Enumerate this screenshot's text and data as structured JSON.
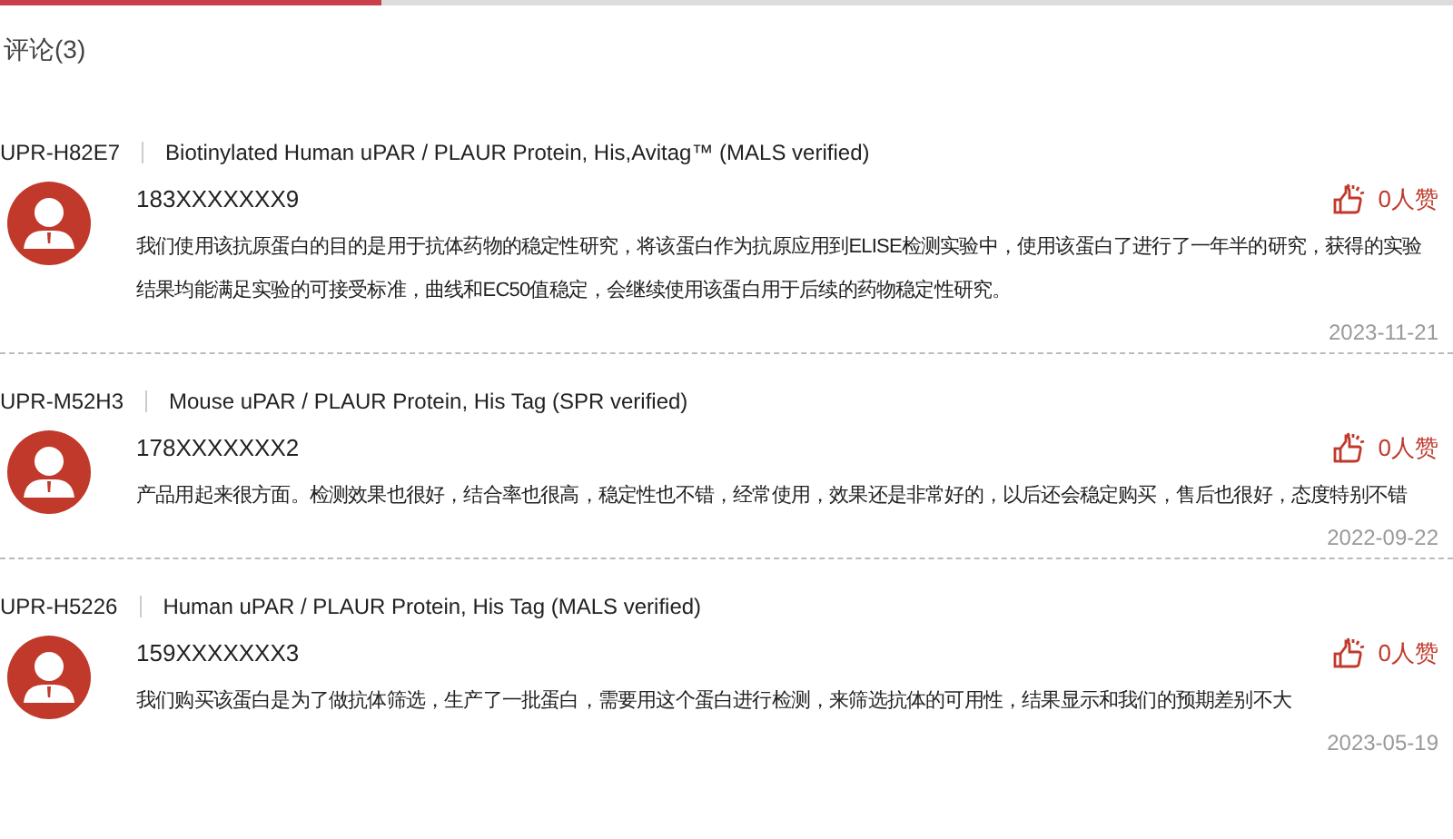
{
  "heading": "评论(3)",
  "reviews": [
    {
      "sku": "UPR-H82E7",
      "product": "Biotinylated Human uPAR / PLAUR Protein, His,Avitag™ (MALS verified)",
      "user": "183XXXXXXX9",
      "likes": "0人赞",
      "text": "我们使用该抗原蛋白的目的是用于抗体药物的稳定性研究，将该蛋白作为抗原应用到ELISE检测实验中，使用该蛋白了进行了一年半的研究，获得的实验结果均能满足实验的可接受标准，曲线和EC50值稳定，会继续使用该蛋白用于后续的药物稳定性研究。",
      "date": "2023-11-21"
    },
    {
      "sku": "UPR-M52H3",
      "product": "Mouse uPAR / PLAUR Protein, His Tag (SPR verified)",
      "user": "178XXXXXXX2",
      "likes": "0人赞",
      "text": "产品用起来很方面。检测效果也很好，结合率也很高，稳定性也不错，经常使用，效果还是非常好的，以后还会稳定购买，售后也很好，态度特别不错",
      "date": "2022-09-22"
    },
    {
      "sku": "UPR-H5226",
      "product": "Human uPAR / PLAUR Protein, His Tag (MALS verified)",
      "user": "159XXXXXXX3",
      "likes": "0人赞",
      "text": "我们购买该蛋白是为了做抗体筛选，生产了一批蛋白，需要用这个蛋白进行检测，来筛选抗体的可用性，结果显示和我们的预期差别不大",
      "date": "2023-05-19"
    }
  ]
}
